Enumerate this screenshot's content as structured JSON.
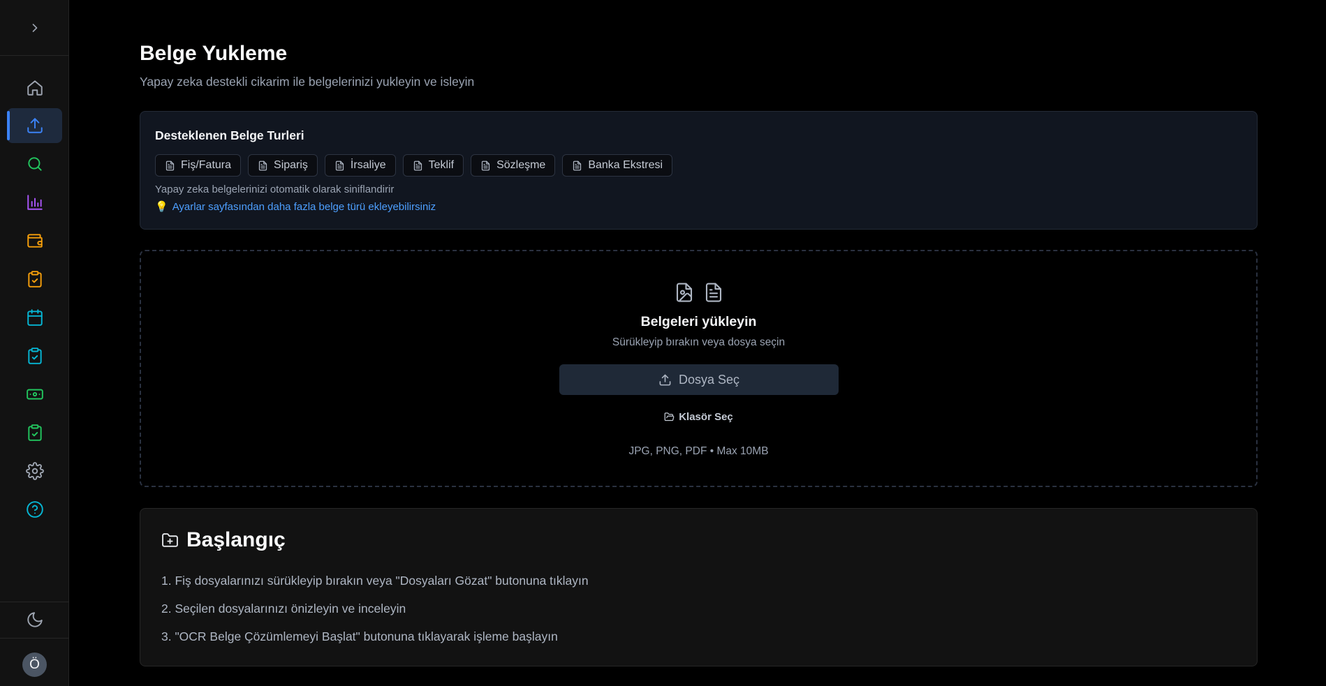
{
  "sidebar": {
    "toggle_icon": "chevron-right-icon",
    "items": [
      {
        "name": "home",
        "icon": "home-icon",
        "color": "#9ca3af",
        "active": false
      },
      {
        "name": "upload",
        "icon": "upload-icon",
        "color": "#3b82f6",
        "active": true
      },
      {
        "name": "search",
        "icon": "search-icon",
        "color": "#22c55e",
        "active": false
      },
      {
        "name": "analytics",
        "icon": "bar-chart-icon",
        "color": "#a855f7",
        "active": false
      },
      {
        "name": "wallet",
        "icon": "wallet-icon",
        "color": "#f59e0b",
        "active": false
      },
      {
        "name": "clipboard-orange",
        "icon": "clipboard-check-icon",
        "color": "#f59e0b",
        "active": false
      },
      {
        "name": "calendar",
        "icon": "calendar-icon",
        "color": "#06b6d4",
        "active": false
      },
      {
        "name": "clipboard-cyan",
        "icon": "clipboard-check-icon",
        "color": "#06b6d4",
        "active": false
      },
      {
        "name": "cash",
        "icon": "banknote-icon",
        "color": "#22c55e",
        "active": false
      },
      {
        "name": "clipboard-green",
        "icon": "clipboard-check-icon",
        "color": "#22c55e",
        "active": false
      },
      {
        "name": "settings",
        "icon": "gear-icon",
        "color": "#9ca3af",
        "active": false
      },
      {
        "name": "help",
        "icon": "help-circle-icon",
        "color": "#06b6d4",
        "active": false
      }
    ],
    "theme_icon": "moon-icon",
    "avatar_initial": "Ö"
  },
  "page": {
    "title": "Belge Yukleme",
    "subtitle": "Yapay zeka destekli cikarim ile belgelerinizi yukleyin ve isleyin"
  },
  "supported_types": {
    "title": "Desteklenen Belge Turleri",
    "chips": [
      "Fiş/Fatura",
      "Sipariş",
      "İrsaliye",
      "Teklif",
      "Sözleşme",
      "Banka Ekstresi"
    ],
    "note": "Yapay zeka belgelerinizi otomatik olarak siniflandirir",
    "hint": "Ayarlar sayfasından daha fazla belge türü ekleyebilirsiniz",
    "hint_emoji": "💡"
  },
  "dropzone": {
    "title": "Belgeleri yükleyin",
    "subtitle": "Sürükleyip bırakın veya dosya seçin",
    "button_label": "Dosya Seç",
    "folder_label": "Klasör Seç",
    "formats": "JPG, PNG, PDF • Max 10MB"
  },
  "getting_started": {
    "title": "Başlangıç",
    "steps": [
      "1. Fiş dosyalarınızı sürükleyip bırakın veya \"Dosyaları Gözat\" butonuna tıklayın",
      "2. Seçilen dosyalarınızı önizleyin ve inceleyin",
      "3. \"OCR Belge Çözümlemeyi Başlat\" butonuna tıklayarak işleme başlayın"
    ]
  },
  "colors": {
    "accent": "#3b82f6",
    "link": "#4d9fff",
    "background": "#000000",
    "sidebar": "#121212"
  }
}
